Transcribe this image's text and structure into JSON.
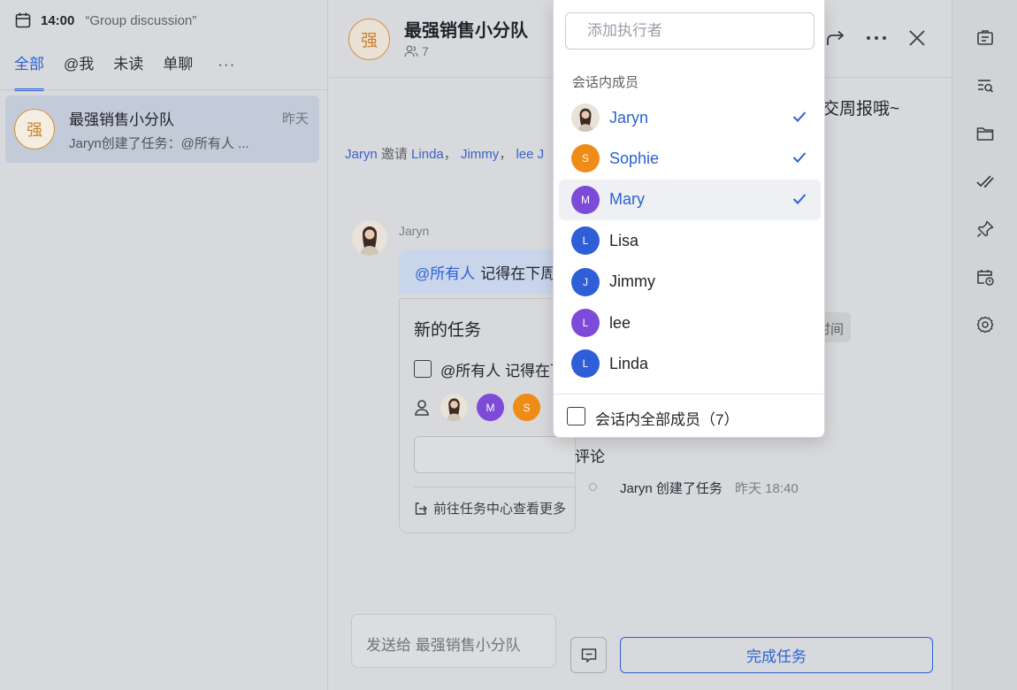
{
  "status": {
    "time": "14:00",
    "group_title": "“Group discussion”"
  },
  "left_panel": {
    "tabs": [
      {
        "label": "全部",
        "active": true
      },
      {
        "label": "@我",
        "active": false
      },
      {
        "label": "未读",
        "active": false
      },
      {
        "label": "单聊",
        "active": false
      }
    ],
    "more_label": "···",
    "chats": [
      {
        "avatar_char": "强",
        "name": "最强销售小分队",
        "time": "昨天",
        "preview": "Jaryn创建了任务：@所有人 ..."
      }
    ]
  },
  "chat": {
    "avatar_char": "强",
    "title": "最强销售小分队",
    "member_count": "7",
    "partial_message": "交周报哦~",
    "system_line": {
      "actor": "Jaryn",
      "verb": "邀请",
      "names": [
        "Linda",
        "Jimmy",
        "lee",
        "J"
      ],
      "sep": "，"
    },
    "message": {
      "sender": "Jaryn",
      "mention": "@所有人",
      "text": "记得在下周"
    },
    "task_card": {
      "title": "新的任务",
      "desc_mention": "@所有人",
      "desc_text": "记得在下周",
      "assignee_avatars": [
        {
          "letter": "",
          "color": "photo"
        },
        {
          "letter": "M",
          "color": "#7d4bd8"
        },
        {
          "letter": "S",
          "color": "#ef8b17"
        }
      ],
      "link_text": "前往任务中心查看更多"
    },
    "chip_text": "时间",
    "comments_title": "评论",
    "log": {
      "text": "Jaryn 创建了任务",
      "time": "昨天 18:40"
    },
    "send_placeholder": "发送给 最强销售小分队",
    "finish_button": "完成任务"
  },
  "dropdown": {
    "search_placeholder": "添加执行者",
    "section_label": "会话内成员",
    "members": [
      {
        "name": "Jaryn",
        "letter": "",
        "color": "photo",
        "selected": true,
        "hover": false
      },
      {
        "name": "Sophie",
        "letter": "S",
        "color": "#ef8b17",
        "selected": true,
        "hover": false
      },
      {
        "name": "Mary",
        "letter": "M",
        "color": "#7d4bd8",
        "selected": true,
        "hover": true
      },
      {
        "name": "Lisa",
        "letter": "L",
        "color": "#2f5fd6",
        "selected": false,
        "hover": false
      },
      {
        "name": "Jimmy",
        "letter": "J",
        "color": "#2f5fd6",
        "selected": false,
        "hover": false
      },
      {
        "name": "lee",
        "letter": "L",
        "color": "#7d4bd8",
        "selected": false,
        "hover": false
      },
      {
        "name": "Linda",
        "letter": "L",
        "color": "#2f5fd6",
        "selected": false,
        "hover": false
      }
    ],
    "all_members_label": "会话内全部成员（7）"
  },
  "right_sidebar": {
    "icons": [
      "task-card-icon",
      "search-list-icon",
      "folder-icon",
      "check-done-icon",
      "pin-icon",
      "calendar-clock-icon",
      "settings-icon"
    ]
  },
  "colors": {
    "accent": "#2a62d6",
    "brand_orange": "#d3913b"
  }
}
